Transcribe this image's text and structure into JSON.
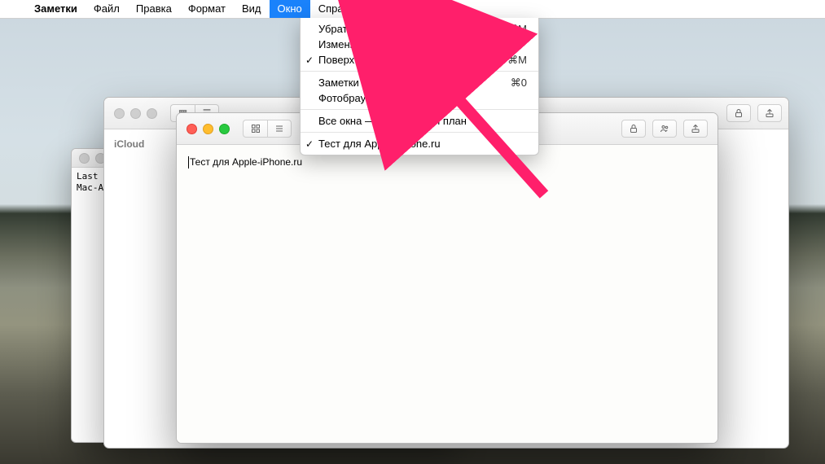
{
  "menubar": {
    "apple": "",
    "app": "Заметки",
    "items": [
      "Файл",
      "Правка",
      "Формат",
      "Вид",
      "Окно",
      "Справка"
    ],
    "selected_index": 4
  },
  "dropdown": {
    "items": [
      {
        "label": "Убрать в Dock",
        "shortcut": "⌘M",
        "checked": false
      },
      {
        "label": "Изменить масштаб",
        "shortcut": "",
        "checked": false
      },
      {
        "label": "Поверх всех окон",
        "shortcut": "⇧⌘M",
        "checked": true
      }
    ],
    "items2": [
      {
        "label": "Заметки",
        "shortcut": "⌘0",
        "checked": false
      },
      {
        "label": "Фотобраузер",
        "shortcut": "",
        "checked": false
      }
    ],
    "items3": [
      {
        "label": "Все окна — на передний план",
        "shortcut": "",
        "checked": false
      }
    ],
    "items4": [
      {
        "label": "Тест для Apple-iPhone.ru",
        "shortcut": "",
        "checked": true
      }
    ]
  },
  "terminal": {
    "line1": "Last login: Thu M",
    "line2": "Mac-Admin:~ admin"
  },
  "notes_back": {
    "sidebar_label": "iCloud"
  },
  "notes_front": {
    "content": "Тест для Apple-iPhone.ru"
  },
  "icons": {
    "grid": "▦",
    "list": "☰",
    "lock": "🔒",
    "people": "👥",
    "share": "⇪"
  }
}
